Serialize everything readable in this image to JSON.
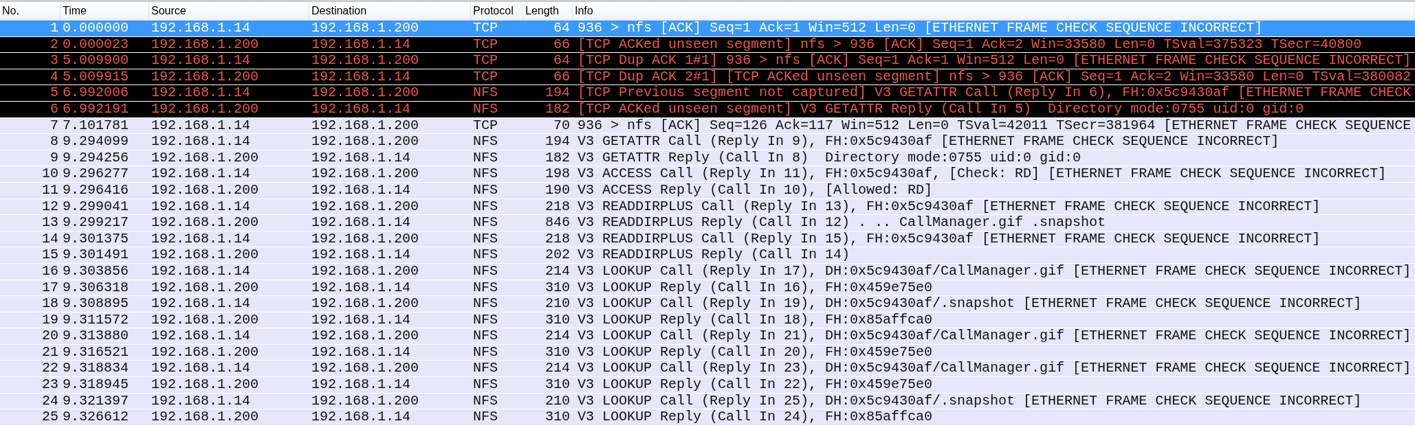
{
  "columns": [
    "No.",
    "Time",
    "Source",
    "Destination",
    "Protocol",
    "Length",
    "Info"
  ],
  "rows": [
    {
      "no": "1",
      "time": "0.000000",
      "source": "192.168.1.14",
      "destination": "192.168.1.200",
      "protocol": "TCP",
      "length": "64",
      "info": "936 > nfs [ACK] Seq=1 Ack=1 Win=512 Len=0 [ETHERNET FRAME CHECK SEQUENCE INCORRECT]",
      "selected": true,
      "kind": "normal"
    },
    {
      "no": "2",
      "time": "0.000023",
      "source": "192.168.1.200",
      "destination": "192.168.1.14",
      "protocol": "TCP",
      "length": "66",
      "info": "[TCP ACKed unseen segment] nfs > 936 [ACK] Seq=1 Ack=2 Win=33580 Len=0 TSval=375323 TSecr=40800",
      "selected": false,
      "kind": "bad"
    },
    {
      "no": "3",
      "time": "5.009900",
      "source": "192.168.1.14",
      "destination": "192.168.1.200",
      "protocol": "TCP",
      "length": "64",
      "info": "[TCP Dup ACK 1#1] 936 > nfs [ACK] Seq=1 Ack=1 Win=512 Len=0 [ETHERNET FRAME CHECK SEQUENCE INCORRECT]",
      "selected": false,
      "kind": "bad"
    },
    {
      "no": "4",
      "time": "5.009915",
      "source": "192.168.1.200",
      "destination": "192.168.1.14",
      "protocol": "TCP",
      "length": "66",
      "info": "[TCP Dup ACK 2#1] [TCP ACKed unseen segment] nfs > 936 [ACK] Seq=1 Ack=2 Win=33580 Len=0 TSval=380082",
      "selected": false,
      "kind": "bad"
    },
    {
      "no": "5",
      "time": "6.992006",
      "source": "192.168.1.14",
      "destination": "192.168.1.200",
      "protocol": "NFS",
      "length": "194",
      "info": "[TCP Previous segment not captured] V3 GETATTR Call (Reply In 6), FH:0x5c9430af [ETHERNET FRAME CHECK",
      "selected": false,
      "kind": "bad"
    },
    {
      "no": "6",
      "time": "6.992191",
      "source": "192.168.1.200",
      "destination": "192.168.1.14",
      "protocol": "NFS",
      "length": "182",
      "info": "[TCP ACKed unseen segment] V3 GETATTR Reply (Call In 5)  Directory mode:0755 uid:0 gid:0",
      "selected": false,
      "kind": "bad"
    },
    {
      "no": "7",
      "time": "7.101781",
      "source": "192.168.1.14",
      "destination": "192.168.1.200",
      "protocol": "TCP",
      "length": "70",
      "info": "936 > nfs [ACK] Seq=126 Ack=117 Win=512 Len=0 TSval=42011 TSecr=381964 [ETHERNET FRAME CHECK SEQUENCE",
      "selected": false,
      "kind": "normal"
    },
    {
      "no": "8",
      "time": "9.294099",
      "source": "192.168.1.14",
      "destination": "192.168.1.200",
      "protocol": "NFS",
      "length": "194",
      "info": "V3 GETATTR Call (Reply In 9), FH:0x5c9430af [ETHERNET FRAME CHECK SEQUENCE INCORRECT]",
      "selected": false,
      "kind": "normal"
    },
    {
      "no": "9",
      "time": "9.294256",
      "source": "192.168.1.200",
      "destination": "192.168.1.14",
      "protocol": "NFS",
      "length": "182",
      "info": "V3 GETATTR Reply (Call In 8)  Directory mode:0755 uid:0 gid:0",
      "selected": false,
      "kind": "normal"
    },
    {
      "no": "10",
      "time": "9.296277",
      "source": "192.168.1.14",
      "destination": "192.168.1.200",
      "protocol": "NFS",
      "length": "198",
      "info": "V3 ACCESS Call (Reply In 11), FH:0x5c9430af, [Check: RD] [ETHERNET FRAME CHECK SEQUENCE INCORRECT]",
      "selected": false,
      "kind": "normal"
    },
    {
      "no": "11",
      "time": "9.296416",
      "source": "192.168.1.200",
      "destination": "192.168.1.14",
      "protocol": "NFS",
      "length": "190",
      "info": "V3 ACCESS Reply (Call In 10), [Allowed: RD]",
      "selected": false,
      "kind": "normal"
    },
    {
      "no": "12",
      "time": "9.299041",
      "source": "192.168.1.14",
      "destination": "192.168.1.200",
      "protocol": "NFS",
      "length": "218",
      "info": "V3 READDIRPLUS Call (Reply In 13), FH:0x5c9430af [ETHERNET FRAME CHECK SEQUENCE INCORRECT]",
      "selected": false,
      "kind": "normal"
    },
    {
      "no": "13",
      "time": "9.299217",
      "source": "192.168.1.200",
      "destination": "192.168.1.14",
      "protocol": "NFS",
      "length": "846",
      "info": "V3 READDIRPLUS Reply (Call In 12) . .. CallManager.gif .snapshot",
      "selected": false,
      "kind": "normal"
    },
    {
      "no": "14",
      "time": "9.301375",
      "source": "192.168.1.14",
      "destination": "192.168.1.200",
      "protocol": "NFS",
      "length": "218",
      "info": "V3 READDIRPLUS Call (Reply In 15), FH:0x5c9430af [ETHERNET FRAME CHECK SEQUENCE INCORRECT]",
      "selected": false,
      "kind": "normal"
    },
    {
      "no": "15",
      "time": "9.301491",
      "source": "192.168.1.200",
      "destination": "192.168.1.14",
      "protocol": "NFS",
      "length": "202",
      "info": "V3 READDIRPLUS Reply (Call In 14)",
      "selected": false,
      "kind": "normal"
    },
    {
      "no": "16",
      "time": "9.303856",
      "source": "192.168.1.14",
      "destination": "192.168.1.200",
      "protocol": "NFS",
      "length": "214",
      "info": "V3 LOOKUP Call (Reply In 17), DH:0x5c9430af/CallManager.gif [ETHERNET FRAME CHECK SEQUENCE INCORRECT]",
      "selected": false,
      "kind": "normal"
    },
    {
      "no": "17",
      "time": "9.306318",
      "source": "192.168.1.200",
      "destination": "192.168.1.14",
      "protocol": "NFS",
      "length": "310",
      "info": "V3 LOOKUP Reply (Call In 16), FH:0x459e75e0",
      "selected": false,
      "kind": "normal"
    },
    {
      "no": "18",
      "time": "9.308895",
      "source": "192.168.1.14",
      "destination": "192.168.1.200",
      "protocol": "NFS",
      "length": "210",
      "info": "V3 LOOKUP Call (Reply In 19), DH:0x5c9430af/.snapshot [ETHERNET FRAME CHECK SEQUENCE INCORRECT]",
      "selected": false,
      "kind": "normal"
    },
    {
      "no": "19",
      "time": "9.311572",
      "source": "192.168.1.200",
      "destination": "192.168.1.14",
      "protocol": "NFS",
      "length": "310",
      "info": "V3 LOOKUP Reply (Call In 18), FH:0x85affca0",
      "selected": false,
      "kind": "normal"
    },
    {
      "no": "20",
      "time": "9.313880",
      "source": "192.168.1.14",
      "destination": "192.168.1.200",
      "protocol": "NFS",
      "length": "214",
      "info": "V3 LOOKUP Call (Reply In 21), DH:0x5c9430af/CallManager.gif [ETHERNET FRAME CHECK SEQUENCE INCORRECT]",
      "selected": false,
      "kind": "normal"
    },
    {
      "no": "21",
      "time": "9.316521",
      "source": "192.168.1.200",
      "destination": "192.168.1.14",
      "protocol": "NFS",
      "length": "310",
      "info": "V3 LOOKUP Reply (Call In 20), FH:0x459e75e0",
      "selected": false,
      "kind": "normal"
    },
    {
      "no": "22",
      "time": "9.318834",
      "source": "192.168.1.14",
      "destination": "192.168.1.200",
      "protocol": "NFS",
      "length": "214",
      "info": "V3 LOOKUP Call (Reply In 23), DH:0x5c9430af/CallManager.gif [ETHERNET FRAME CHECK SEQUENCE INCORRECT]",
      "selected": false,
      "kind": "normal"
    },
    {
      "no": "23",
      "time": "9.318945",
      "source": "192.168.1.200",
      "destination": "192.168.1.14",
      "protocol": "NFS",
      "length": "310",
      "info": "V3 LOOKUP Reply (Call In 22), FH:0x459e75e0",
      "selected": false,
      "kind": "normal"
    },
    {
      "no": "24",
      "time": "9.321397",
      "source": "192.168.1.14",
      "destination": "192.168.1.200",
      "protocol": "NFS",
      "length": "210",
      "info": "V3 LOOKUP Call (Reply In 25), DH:0x5c9430af/.snapshot [ETHERNET FRAME CHECK SEQUENCE INCORRECT]",
      "selected": false,
      "kind": "normal"
    },
    {
      "no": "25",
      "time": "9.326612",
      "source": "192.168.1.200",
      "destination": "192.168.1.14",
      "protocol": "NFS",
      "length": "310",
      "info": "V3 LOOKUP Reply (Call In 24), FH:0x85affca0",
      "selected": false,
      "kind": "normal"
    }
  ]
}
